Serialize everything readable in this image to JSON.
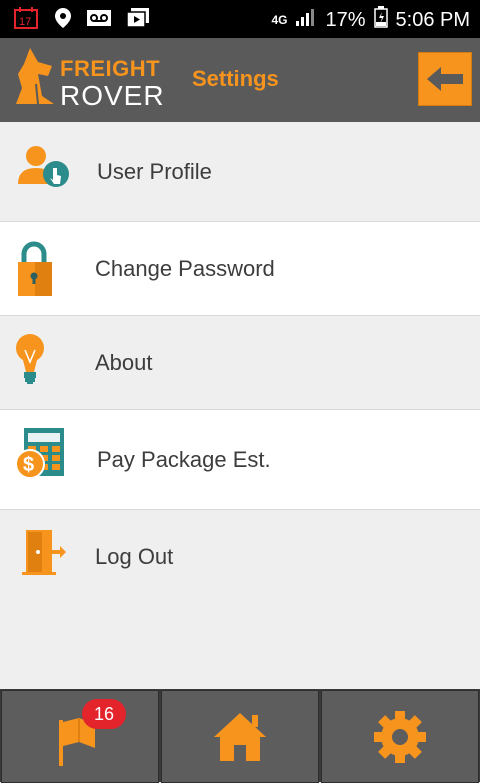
{
  "status_bar": {
    "network": "4G",
    "battery": "17%",
    "time": "5:06 PM",
    "notification_icons": [
      "calendar-icon",
      "location-icon",
      "voicemail-icon",
      "media-icon"
    ]
  },
  "header": {
    "logo_line1": "FREIGHT",
    "logo_line2": "ROVER",
    "title": "Settings",
    "back_icon": "arrow-left-icon"
  },
  "menu": {
    "items": [
      {
        "label": "User Profile",
        "icon": "user-profile-icon"
      },
      {
        "label": "Change Password",
        "icon": "lock-icon"
      },
      {
        "label": "About",
        "icon": "lightbulb-icon"
      },
      {
        "label": "Pay Package Est.",
        "icon": "calculator-icon"
      },
      {
        "label": "Log Out",
        "icon": "logout-icon"
      }
    ]
  },
  "bottom_nav": {
    "badge_count": "16",
    "items": [
      "flag-icon",
      "home-icon",
      "gear-icon"
    ]
  },
  "colors": {
    "accent": "#f7941d",
    "teal": "#2c8c8c",
    "header_bg": "#5a5a5a",
    "badge": "#e3242b"
  }
}
